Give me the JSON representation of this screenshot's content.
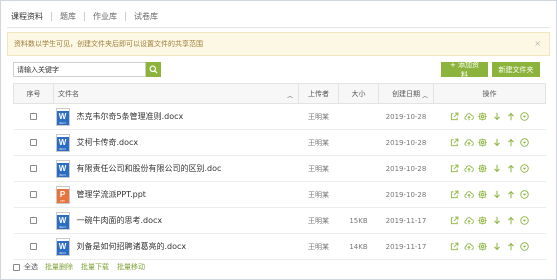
{
  "tabs": [
    "课程资料",
    "题库",
    "作业库",
    "试卷库"
  ],
  "notice": {
    "text": "资料数以学生可见，创建文件夹后即可以设置文件的共享范围",
    "close": "×"
  },
  "search": {
    "placeholder": "请输入关键字"
  },
  "buttons": {
    "add": "+ 添加资料",
    "new_folder": "新建文件夹"
  },
  "table": {
    "headers": {
      "index": "序号",
      "name": "文件名",
      "uploader": "上传者",
      "size": "大小",
      "date": "创建日期",
      "ops": "操作"
    },
    "rows": [
      {
        "name": "杰克韦尔奇5条管理准则.docx",
        "type": "word",
        "uploader": "王明某",
        "size": "",
        "date": "2019-10-28"
      },
      {
        "name": "艾柯卡传奇.docx",
        "type": "word",
        "uploader": "王明某",
        "size": "",
        "date": "2019-10-28"
      },
      {
        "name": "有限责任公司和股份有限公司的区别.doc",
        "type": "word",
        "uploader": "王明某",
        "size": "",
        "date": "2019-10-28"
      },
      {
        "name": "管理学流派PPT.ppt",
        "type": "ppt",
        "uploader": "王明某",
        "size": "",
        "date": "2019-10-28"
      },
      {
        "name": "一碗牛肉面的思考.docx",
        "type": "word",
        "uploader": "王明某",
        "size": "15KB",
        "date": "2019-11-17"
      },
      {
        "name": "刘备是如何招聘诸葛亮的.docx",
        "type": "word",
        "uploader": "王明某",
        "size": "14KB",
        "date": "2019-11-17"
      }
    ]
  },
  "icons": {
    "word_letter": "W",
    "word_tag": "Word",
    "ppt_letter": "P",
    "ppt_tag": "PPT"
  },
  "footer": {
    "select_all": "全选",
    "batch_delete": "批量删除",
    "batch_download": "批量下载",
    "batch_move": "批量移动"
  },
  "colors": {
    "accent": "#8cb43c",
    "word": "#2b6cc4",
    "ppt": "#e8743b",
    "notice_bg": "#fcf8e3"
  }
}
